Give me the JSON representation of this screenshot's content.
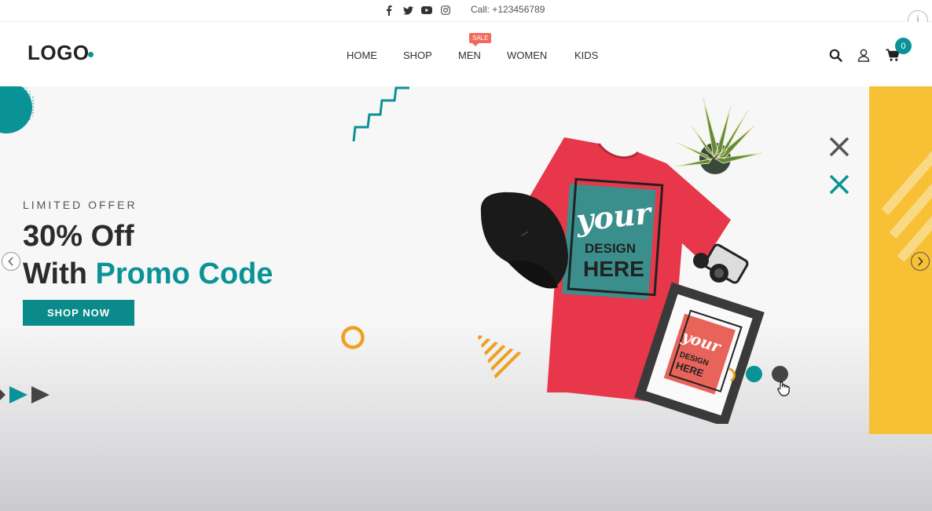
{
  "topbar": {
    "social": [
      "facebook-icon",
      "twitter-icon",
      "youtube-icon",
      "instagram-icon"
    ],
    "call": "Call: +123456789",
    "info_glyph": "i"
  },
  "header": {
    "logo": "LOGO",
    "nav": [
      {
        "label": "HOME"
      },
      {
        "label": "SHOP"
      },
      {
        "label": "MEN",
        "badge": "SALE"
      },
      {
        "label": "WOMEN"
      },
      {
        "label": "KIDS"
      }
    ],
    "cart_count": "0"
  },
  "hero": {
    "eyebrow": "LIMITED OFFER",
    "title_line1": "30% Off",
    "title_line2_prefix": "With ",
    "title_line2_accent": "Promo Code",
    "cta": "SHOP NOW",
    "tshirt_print_script": "your",
    "tshirt_print_line1": "DESIGN",
    "tshirt_print_line2": "HERE",
    "frame_print_script": "your",
    "frame_print_line1": "DESIGN",
    "frame_print_line2": "HERE",
    "active_slide": 1,
    "slide_count": 2
  },
  "colors": {
    "accent": "#0a9396",
    "sale": "#f06b5b",
    "shirt": "#e8374a",
    "panel": "#f7c035",
    "orange": "#f0a020"
  }
}
